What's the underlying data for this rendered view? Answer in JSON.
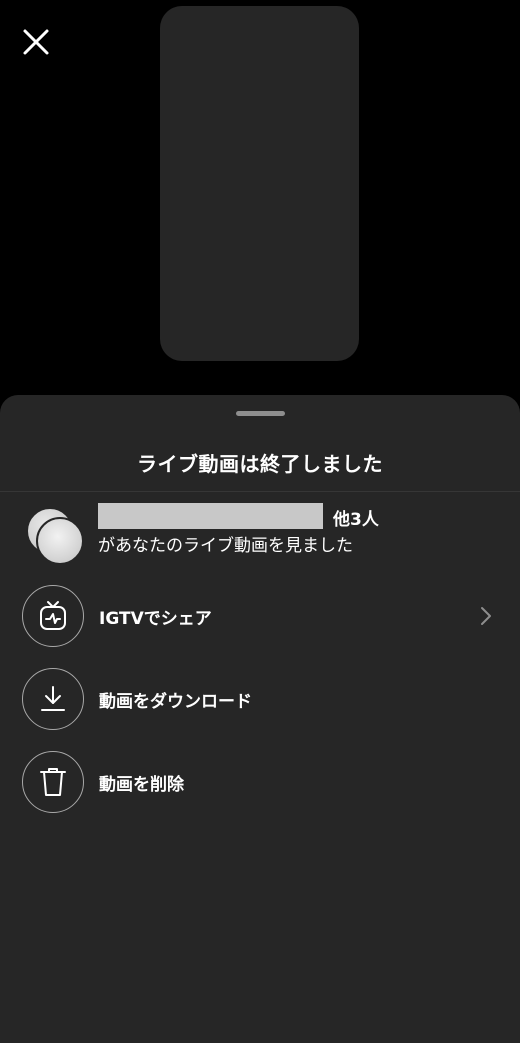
{
  "sheet": {
    "title": "ライブ動画は終了しました"
  },
  "viewers": {
    "others_count": "他3人",
    "subtitle": "があなたのライブ動画を見ました"
  },
  "actions": [
    {
      "label": "IGTVでシェア",
      "icon": "igtv-icon"
    },
    {
      "label": "動画をダウンロード",
      "icon": "download-icon"
    },
    {
      "label": "動画を削除",
      "icon": "trash-icon"
    }
  ],
  "colors": {
    "background": "#000000",
    "sheet": "#262626",
    "text": "#ffffff",
    "icon_outline": "#a8a8a8"
  }
}
